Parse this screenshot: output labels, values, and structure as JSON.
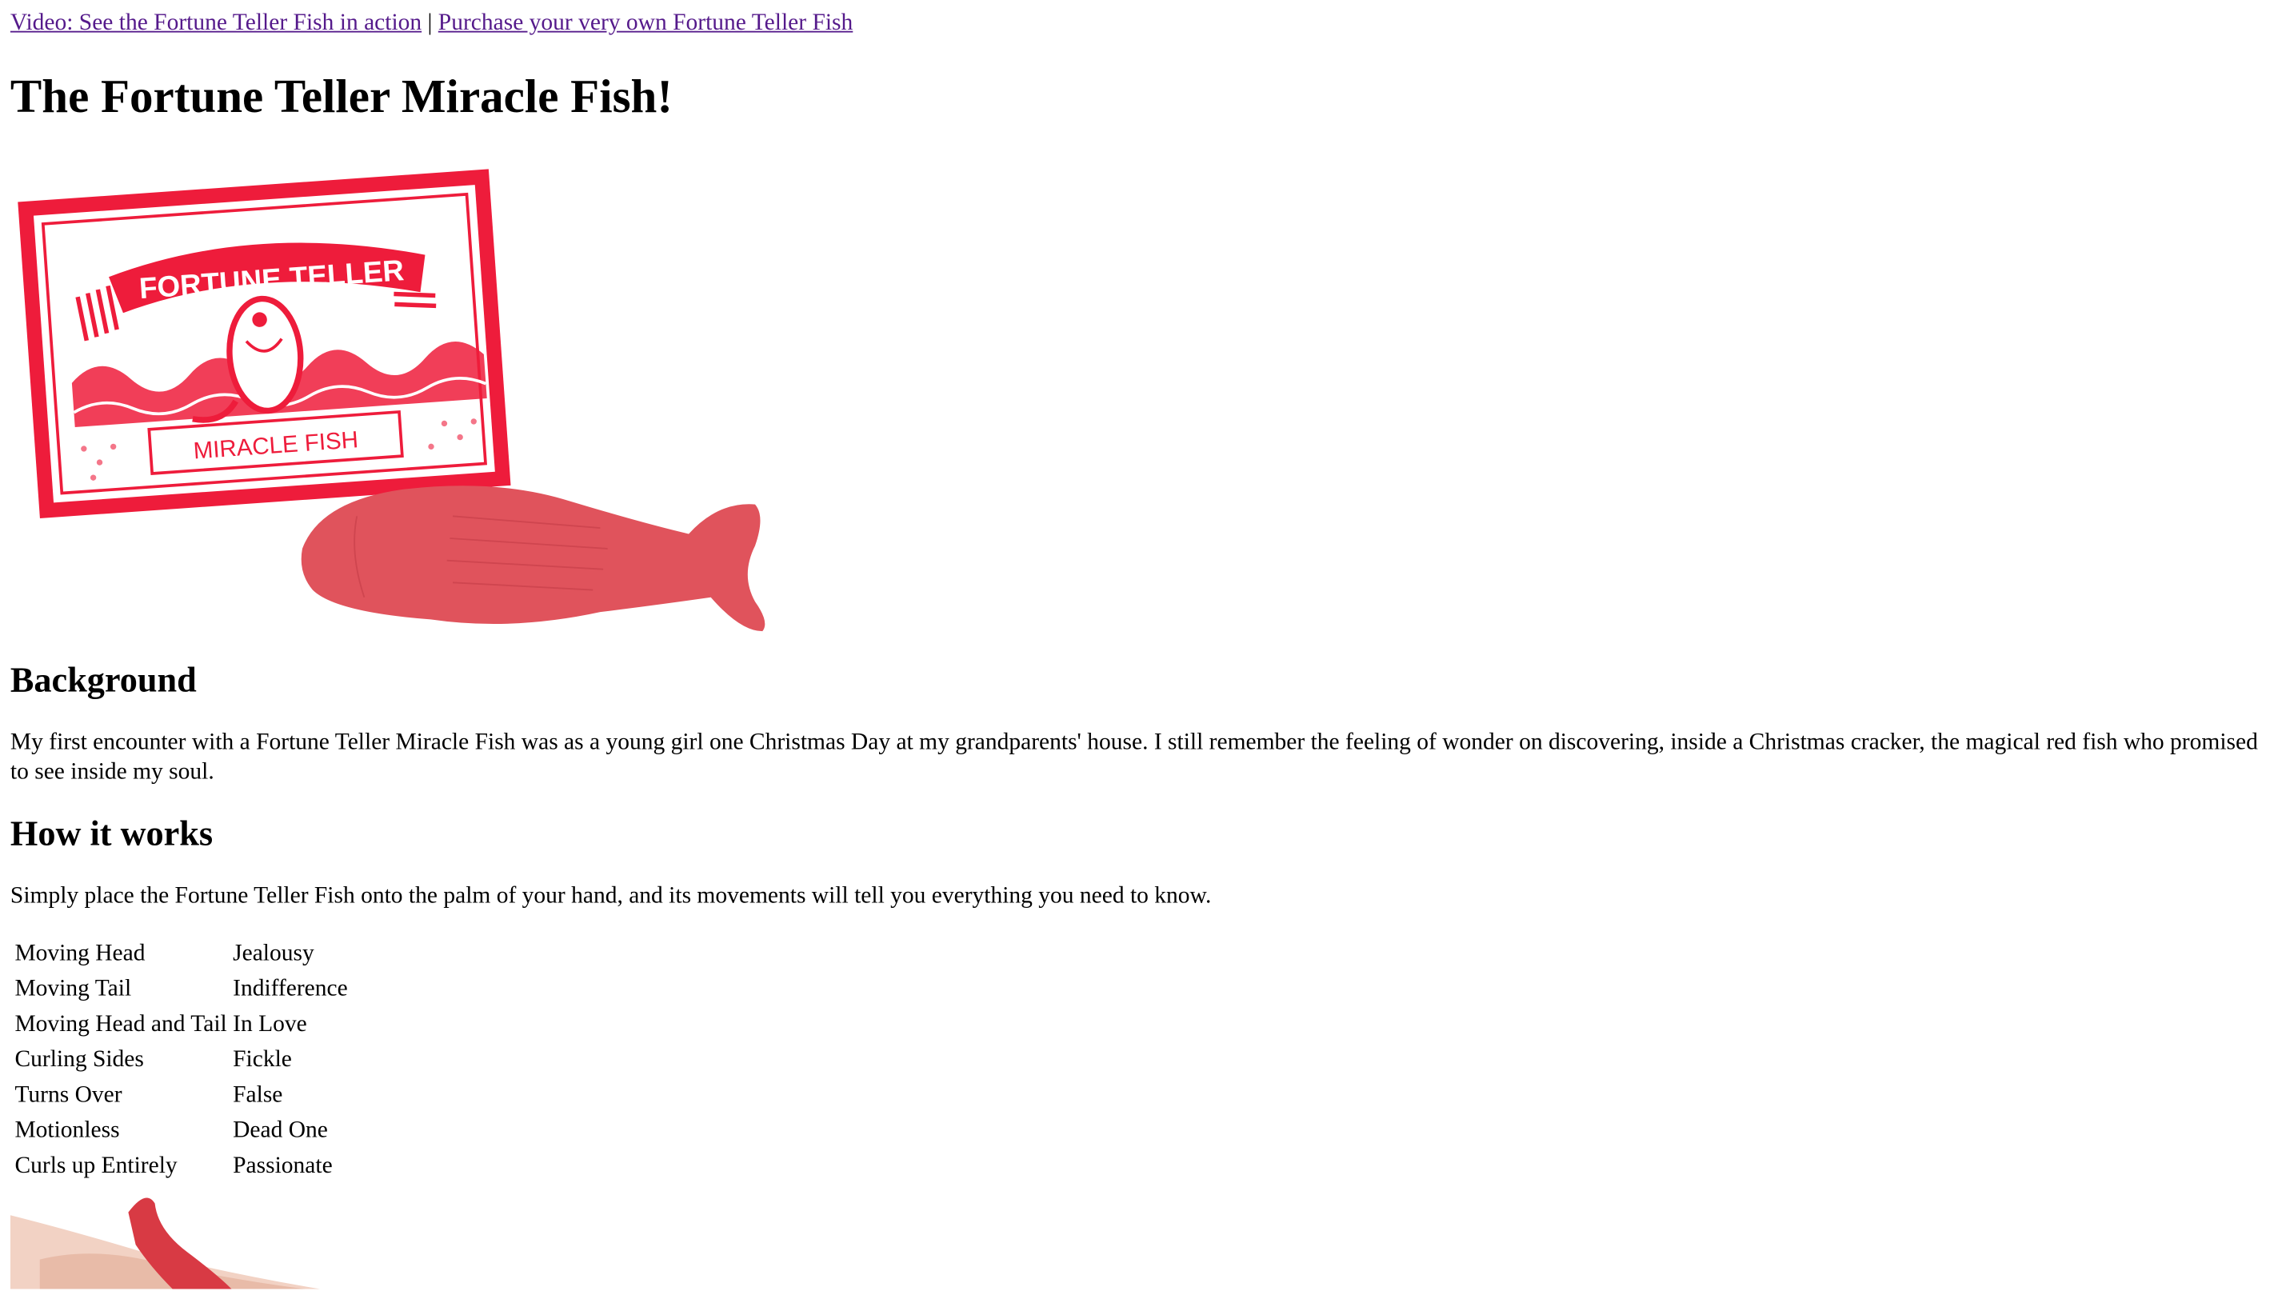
{
  "nav": {
    "video_link": "Video: See the Fortune Teller Fish in action",
    "separator": "|",
    "purchase_link": "Purchase your very own Fortune Teller Fish"
  },
  "page_title": "The Fortune Teller Miracle Fish!",
  "hero_image": {
    "package_top_text": "FORTUNE TELLER",
    "package_bottom_text": "MIRACLE FISH",
    "colors": {
      "package_red": "#ee1c3b",
      "fish_red": "#e0535c"
    }
  },
  "background": {
    "heading": "Background",
    "text": "My first encounter with a Fortune Teller Miracle Fish was as a young girl one Christmas Day at my grandparents' house. I still remember the feeling of wonder on discovering, inside a Christmas cracker, the magical red fish who promised to see inside my soul."
  },
  "how_it_works": {
    "heading": "How it works",
    "text": "Simply place the Fortune Teller Fish onto the palm of your hand, and its movements will tell you everything you need to know.",
    "rows": [
      {
        "movement": "Moving Head",
        "meaning": "Jealousy"
      },
      {
        "movement": "Moving Tail",
        "meaning": "Indifference"
      },
      {
        "movement": "Moving Head and Tail",
        "meaning": "In Love"
      },
      {
        "movement": "Curling Sides",
        "meaning": "Fickle"
      },
      {
        "movement": "Turns Over",
        "meaning": "False"
      },
      {
        "movement": "Motionless",
        "meaning": "Dead One"
      },
      {
        "movement": "Curls up Entirely",
        "meaning": "Passionate"
      }
    ]
  }
}
